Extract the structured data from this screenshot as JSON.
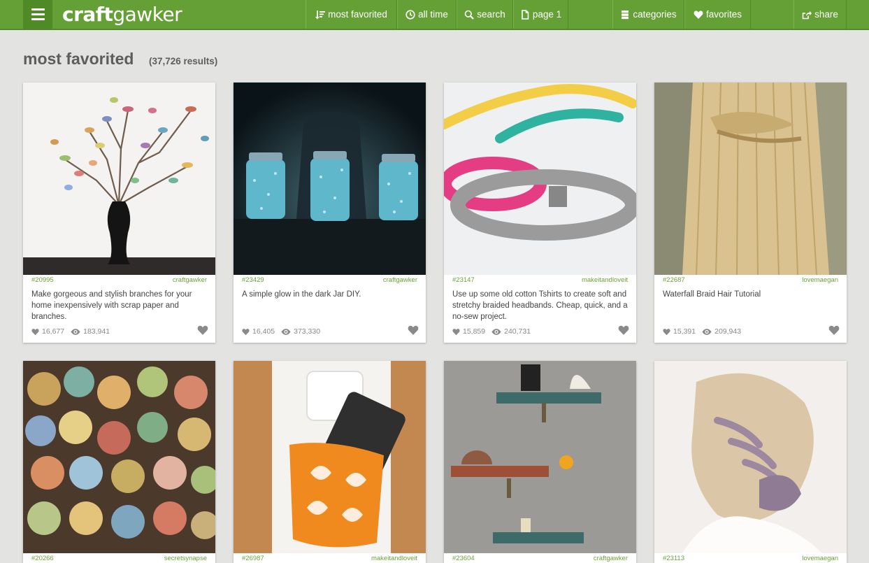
{
  "brand": {
    "logo_bold": "craft",
    "logo_light": "gawker"
  },
  "nav": {
    "most_favorited": "most favorited",
    "all_time": "all time",
    "search": "search",
    "page": "page 1",
    "categories": "categories",
    "favorites": "favorites",
    "share": "share"
  },
  "heading": {
    "title": "most favorited",
    "results": "(37,726 results)"
  },
  "cards": [
    {
      "id": "#20995",
      "source": "craftgawker",
      "description": "Make gorgeous and stylish branches for your home inexpensively with scrap paper and branches.",
      "favorites": "16,677",
      "views": "183,941"
    },
    {
      "id": "#23429",
      "source": "craftgawker",
      "description": "A simple glow in the dark Jar DIY.",
      "favorites": "16,405",
      "views": "373,330"
    },
    {
      "id": "#23147",
      "source": "makeitandloveit",
      "description": "Use up some old cotton Tshirts to create soft and stretchy braided headbands. Cheap, quick, and a no-sew project.",
      "favorites": "15,859",
      "views": "240,731"
    },
    {
      "id": "#22687",
      "source": "lovemaegan",
      "description": "Waterfall Braid Hair Tutorial",
      "favorites": "15,391",
      "views": "209,943"
    },
    {
      "id": "#20266",
      "source": "secretsynapse"
    },
    {
      "id": "#26987",
      "source": "makeitandloveit"
    },
    {
      "id": "#23604",
      "source": "craftgawker"
    },
    {
      "id": "#23113",
      "source": "lovemaegan"
    }
  ],
  "colors": {
    "brand_green": "#64a035",
    "dark_green": "#4f8a26",
    "link_green": "#6aa23a",
    "background": "#e3e3e1"
  },
  "icons": [
    "menu-icon",
    "sort-icon",
    "clock-icon",
    "search-icon",
    "page-icon",
    "categories-icon",
    "heart-icon",
    "share-icon",
    "eye-icon"
  ]
}
